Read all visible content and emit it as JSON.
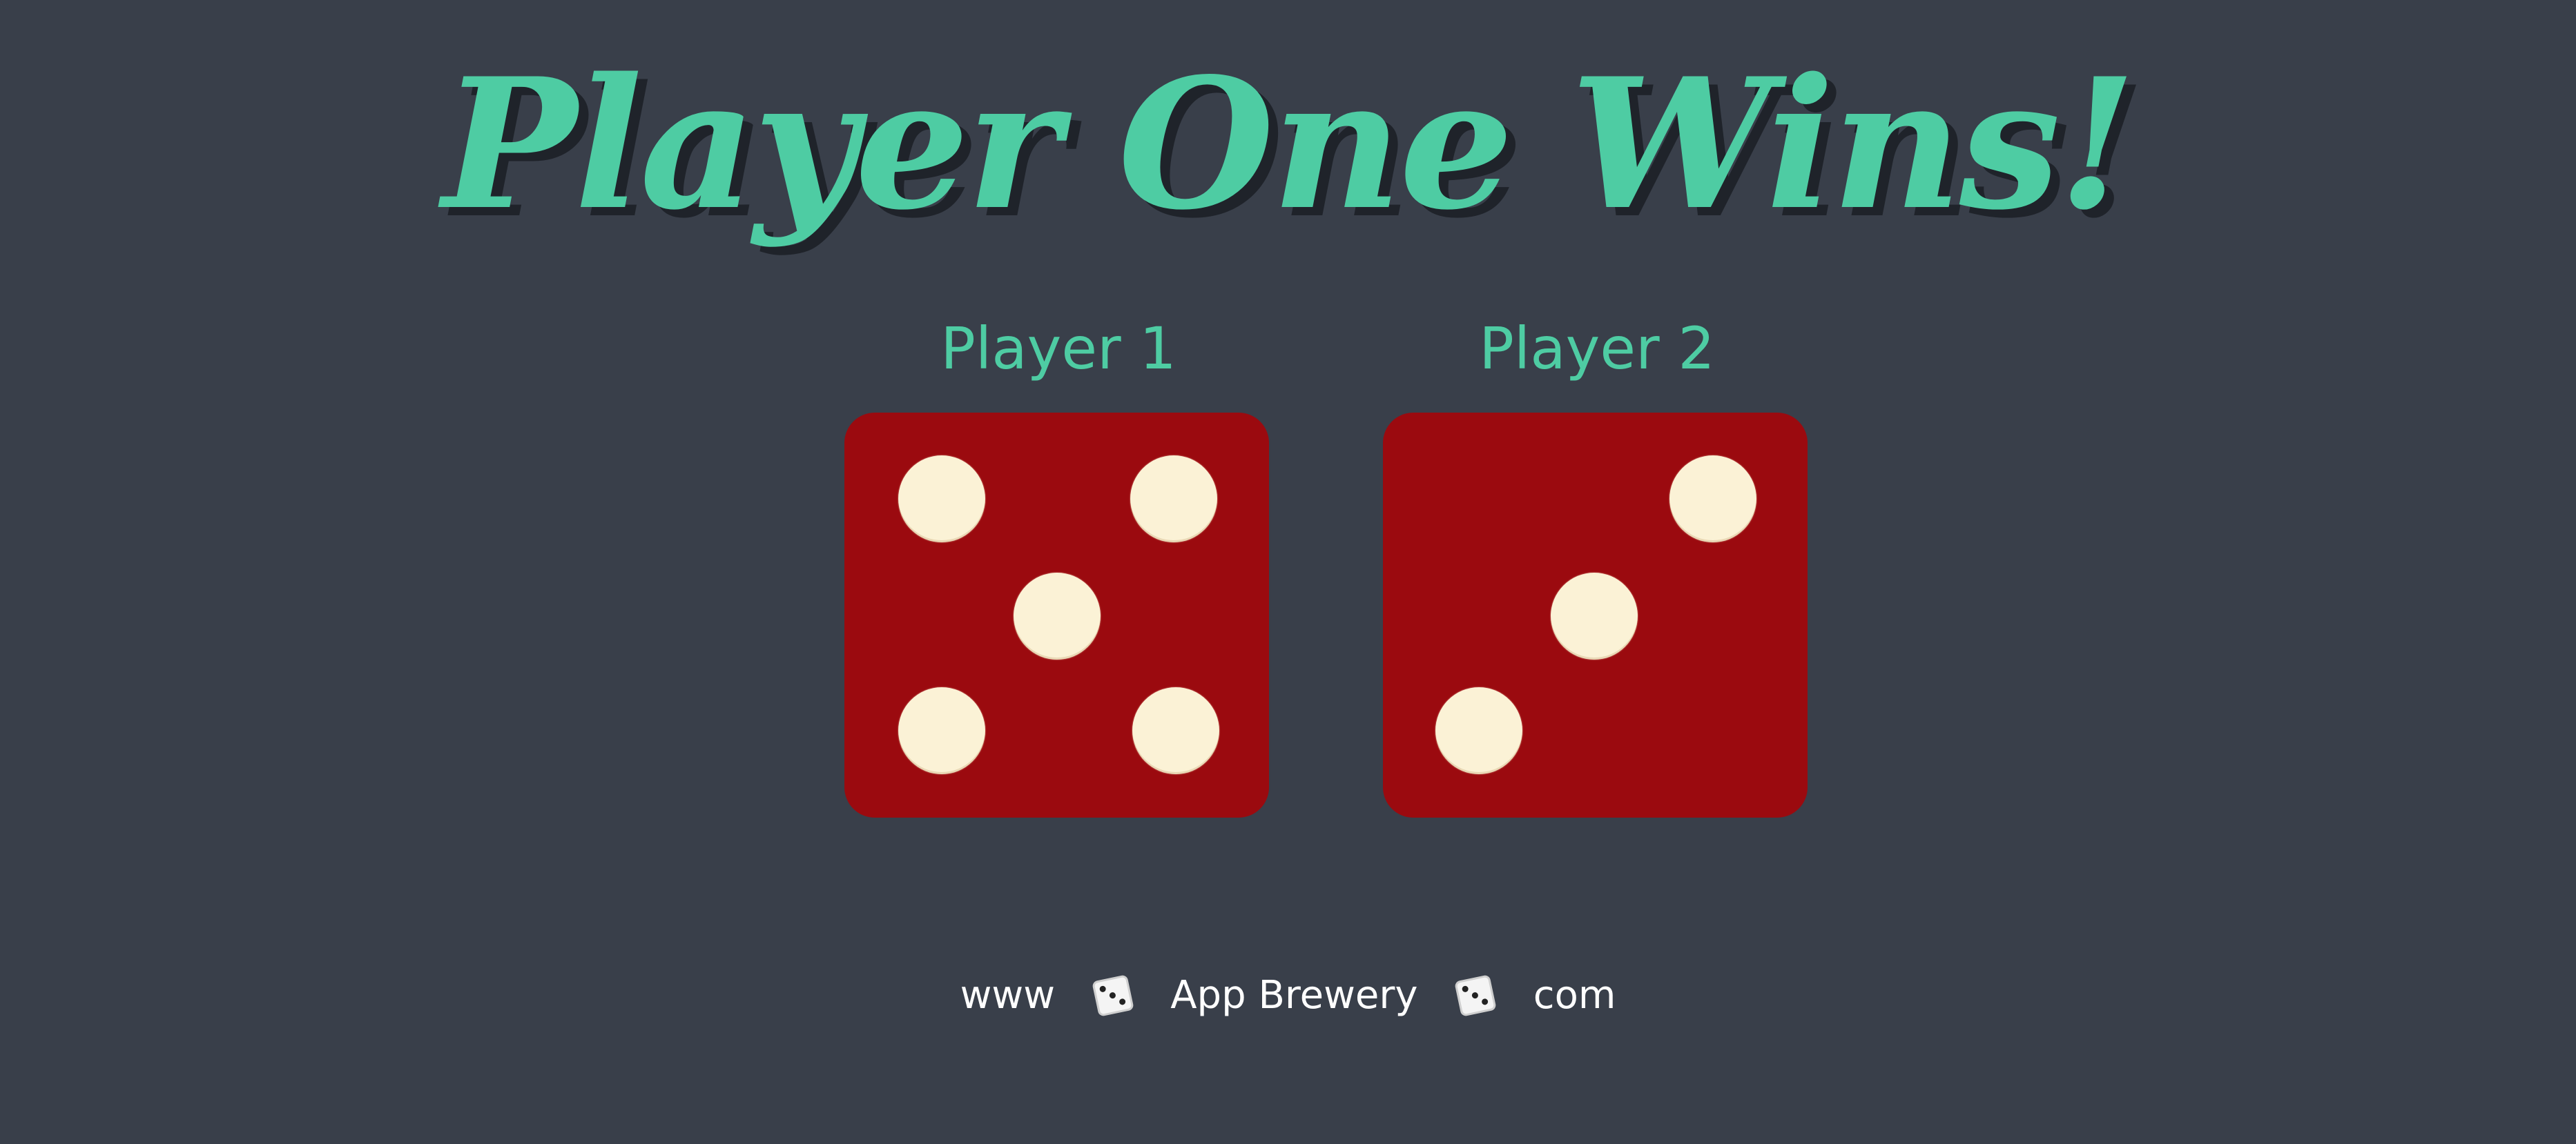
{
  "title": "Player One Wins!",
  "players": [
    {
      "label": "Player 1",
      "die_value": 5
    },
    {
      "label": "Player 2",
      "die_value": 3
    }
  ],
  "footer": {
    "prefix": "www",
    "middle": "App Brewery",
    "suffix": "com",
    "separator_icon": "dice-icon"
  },
  "colors": {
    "background": "#393f4a",
    "accent": "#4ecca3",
    "die": "#9b0a0f",
    "pip": "#fbf2d6",
    "footer_text": "#ffffff"
  }
}
